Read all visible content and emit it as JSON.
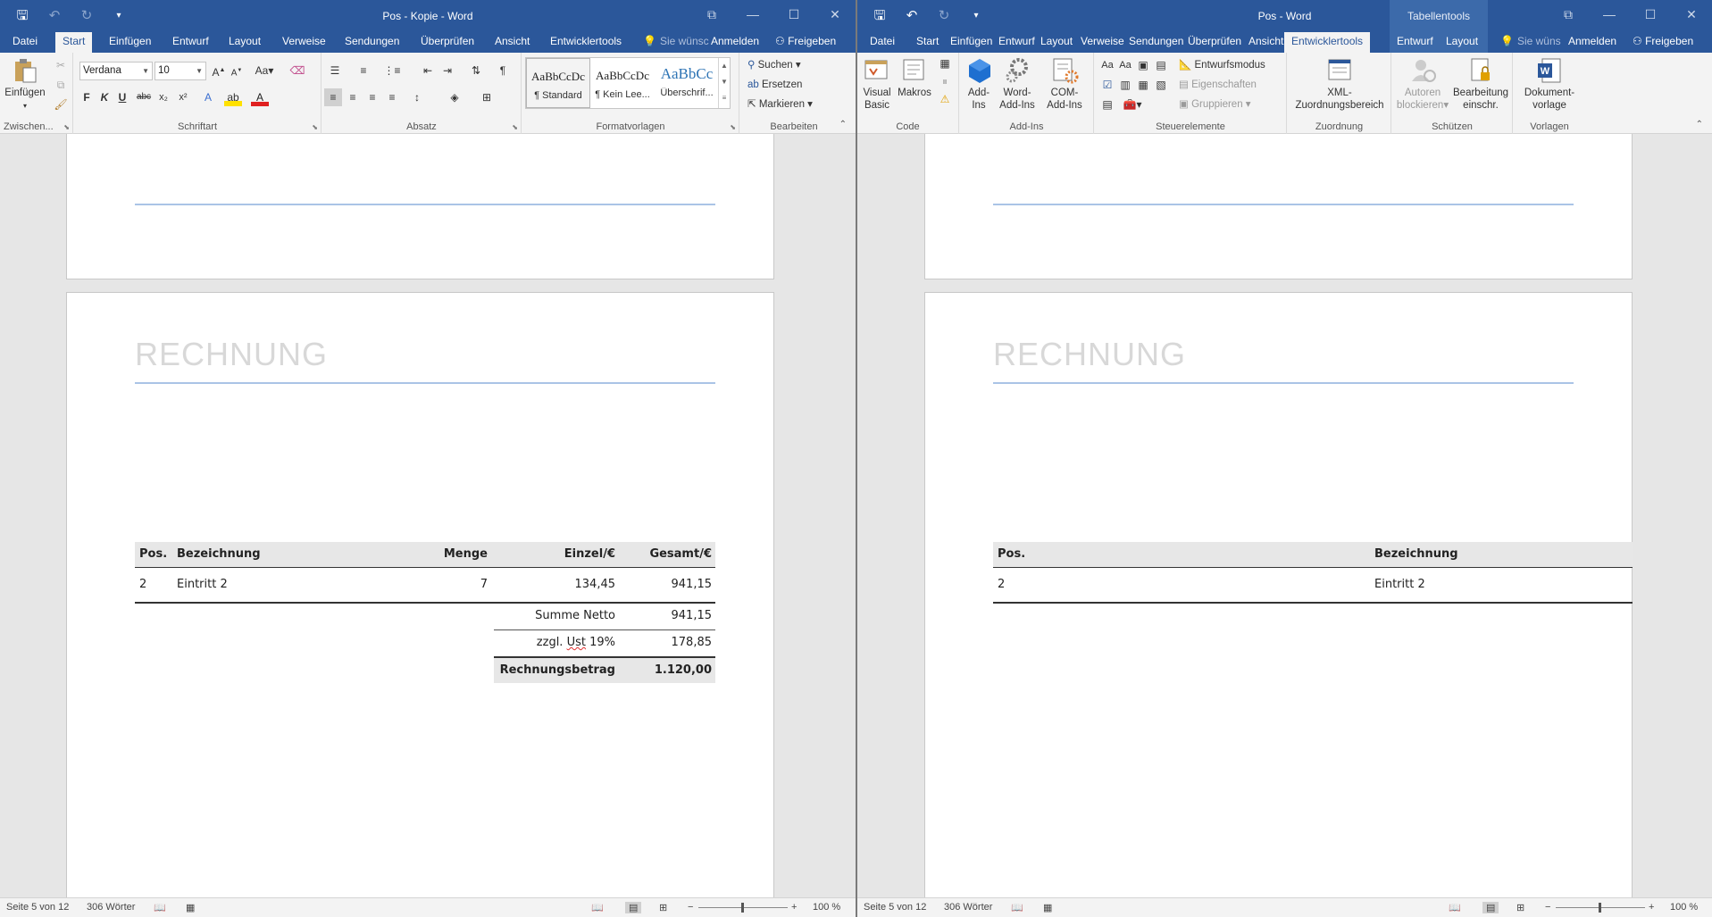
{
  "left": {
    "title": "Pos - Kopie - Word",
    "tabs": [
      "Datei",
      "Start",
      "Einfügen",
      "Entwurf",
      "Layout",
      "Verweise",
      "Sendungen",
      "Überprüfen",
      "Ansicht",
      "Entwicklertools"
    ],
    "tell_me": "Sie wünsc",
    "sign_in": "Anmelden",
    "share": "Freigeben",
    "groups": {
      "clipboard": "Zwischen...",
      "font": "Schriftart",
      "paragraph": "Absatz",
      "styles": "Formatvorlagen",
      "editing": "Bearbeiten"
    },
    "paste_label": "Einfügen",
    "font_name": "Verdana",
    "font_size": "10",
    "change_case": "Aa",
    "styles": [
      {
        "sample": "AaBbCcDc",
        "name": "¶ Standard"
      },
      {
        "sample": "AaBbCcDc",
        "name": "¶ Kein Lee..."
      },
      {
        "sample": "AaBbCc",
        "name": "Überschrif..."
      }
    ],
    "editing": {
      "find": "Suchen",
      "replace": "Ersetzen",
      "select": "Markieren"
    },
    "doc": {
      "heading": "RECHNUNG",
      "table_headers": {
        "pos": "Pos.",
        "desc": "Bezeichnung",
        "qty": "Menge",
        "unit": "Einzel/€",
        "total": "Gesamt/€"
      },
      "row": {
        "pos": "2",
        "desc": "Eintritt 2",
        "qty": "7",
        "unit": "134,45",
        "total": "941,15"
      },
      "summary": {
        "net_label": "Summe Netto",
        "net_value": "941,15",
        "vat_label_pre": "zzgl. ",
        "vat_label_word": "Ust",
        "vat_label_post": " 19%",
        "vat_value": "178,85",
        "total_label": "Rechnungsbetrag",
        "total_value": "1.120,00"
      }
    },
    "status": {
      "page": "Seite 5 von 12",
      "words": "306 Wörter",
      "zoom": "100 %"
    }
  },
  "right": {
    "title": "Pos - Word",
    "context_title": "Tabellentools",
    "tabs": [
      "Datei",
      "Start",
      "Einfügen",
      "Entwurf",
      "Layout",
      "Verweise",
      "Sendungen",
      "Überprüfen",
      "Ansicht",
      "Entwicklertools",
      "Entwurf",
      "Layout"
    ],
    "tell_me": "Sie wüns",
    "sign_in": "Anmelden",
    "share": "Freigeben",
    "groups": {
      "code": "Code",
      "addins": "Add-Ins",
      "controls": "Steuerelemente",
      "mapping": "Zuordnung",
      "protect": "Schützen",
      "templates": "Vorlagen"
    },
    "buttons": {
      "visual_basic": [
        "Visual",
        "Basic"
      ],
      "macros": "Makros",
      "addins": [
        "Add-",
        "Ins"
      ],
      "word_addins": [
        "Word-",
        "Add-Ins"
      ],
      "com_addins": [
        "COM-",
        "Add-Ins"
      ],
      "design_mode": "Entwurfsmodus",
      "properties": "Eigenschaften",
      "group": "Gruppieren",
      "xml_mapping": [
        "XML-",
        "Zuordnungsbereich"
      ],
      "block_authors": [
        "Autoren",
        "blockieren"
      ],
      "restrict_editing": [
        "Bearbeitung",
        "einschr."
      ],
      "doc_template": [
        "Dokument-",
        "vorlage"
      ]
    },
    "doc": {
      "heading": "RECHNUNG",
      "table_headers": {
        "pos": "Pos.",
        "desc": "Bezeichnung"
      },
      "row": {
        "pos": "2",
        "desc": "Eintritt 2"
      }
    },
    "status": {
      "page": "Seite 5 von 12",
      "words": "306 Wörter",
      "zoom": "100 %"
    }
  },
  "colors": {
    "titlebar": "#2b579a",
    "ribbon": "#f3f3f3",
    "accent_line": "#aac4e6"
  }
}
